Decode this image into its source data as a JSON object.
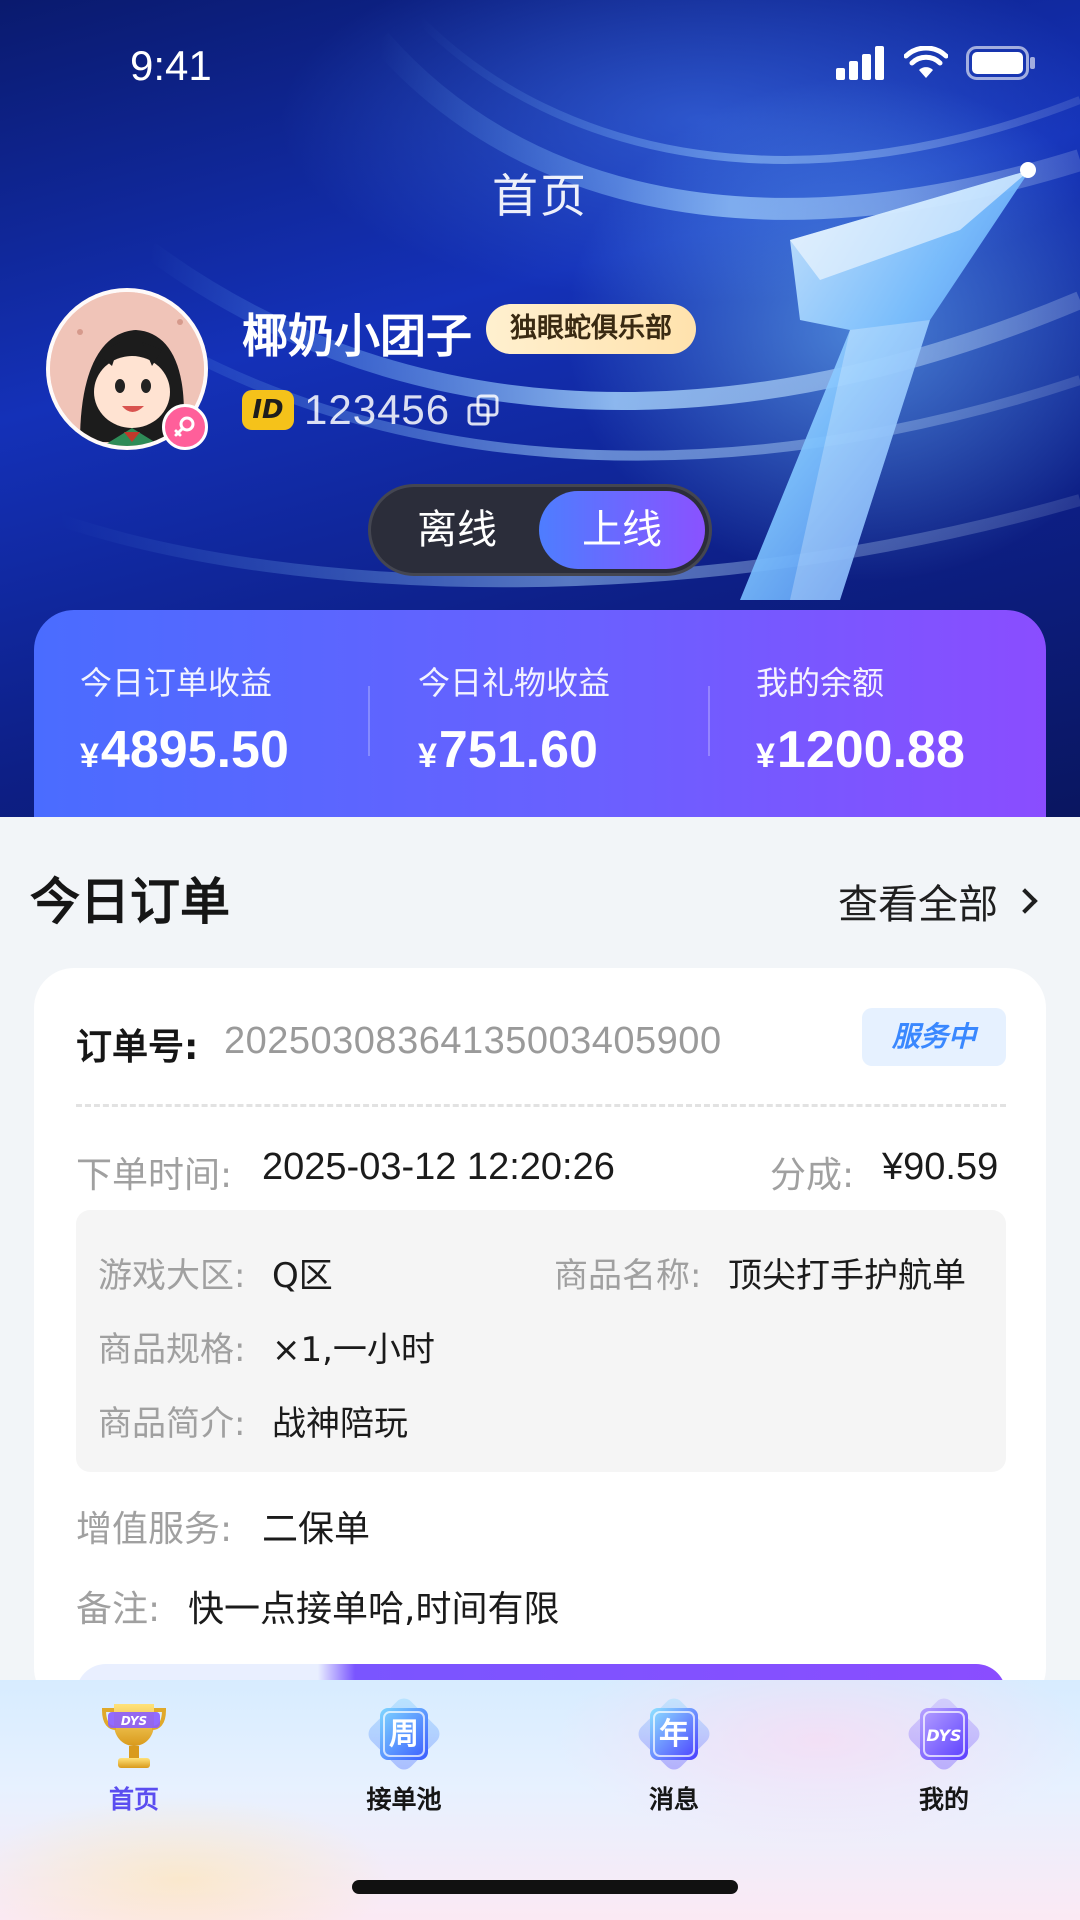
{
  "status_bar": {
    "time": "9:41"
  },
  "header": {
    "title": "首页"
  },
  "profile": {
    "nickname": "椰奶小团子",
    "club": "独眼蛇俱乐部",
    "id_badge": "ID",
    "id_value": "123456",
    "gender_icon": "female-icon"
  },
  "online_toggle": {
    "offline_label": "离线",
    "online_label": "上线",
    "selected": "上线"
  },
  "earnings": {
    "currency": "¥",
    "items": [
      {
        "label": "今日订单收益",
        "value": "4895.50"
      },
      {
        "label": "今日礼物收益",
        "value": "751.60"
      },
      {
        "label": "我的余额",
        "value": "1200.88"
      }
    ]
  },
  "orders_section": {
    "title": "今日订单",
    "view_all": "查看全部"
  },
  "order": {
    "number_label": "订单号:",
    "number": "20250308364135003405900",
    "status": "服务中",
    "time_label": "下单时间:",
    "time": "2025-03-12 12:20:26",
    "commission_label": "分成:",
    "commission": "¥90.59",
    "details": {
      "region_label": "游戏大区:",
      "region": "Q区",
      "product_label": "商品名称:",
      "product": "顶尖打手护航单",
      "spec_label": "商品规格:",
      "spec": "×1,一小时",
      "intro_label": "商品简介:",
      "intro": "战神陪玩"
    },
    "addon_label": "增值服务:",
    "addon": "二保单",
    "note_label": "备注:",
    "note": "快一点接单哈,时间有限"
  },
  "tabbar": {
    "items": [
      {
        "label": "首页",
        "icon": "trophy-icon",
        "glyph": "DYS",
        "active": true
      },
      {
        "label": "接单池",
        "icon": "week-badge-icon",
        "glyph": "周",
        "active": false
      },
      {
        "label": "消息",
        "icon": "year-badge-icon",
        "glyph": "年",
        "active": false
      },
      {
        "label": "我的",
        "icon": "dys-badge-icon",
        "glyph": "DYS",
        "active": false
      }
    ]
  },
  "colors": {
    "accent": "#5a4df0",
    "earnings_gradient_start": "#4a6cff",
    "earnings_gradient_end": "#8a4dff",
    "status_badge_text": "#3a88ff",
    "hero_background": "#1431b8"
  }
}
